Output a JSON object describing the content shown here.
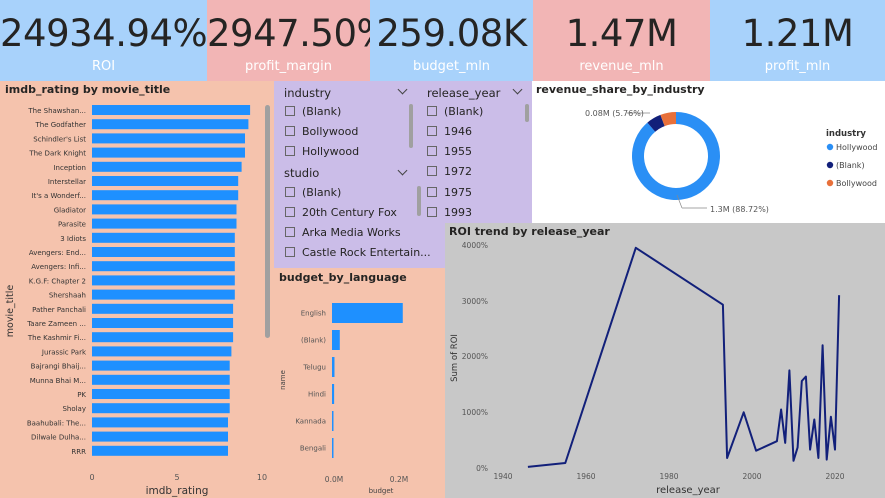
{
  "kpis": [
    {
      "value": "24934.94%",
      "label": "ROI",
      "color": "blue"
    },
    {
      "value": "2947.50%",
      "label": "profit_margin",
      "color": "pink"
    },
    {
      "value": "259.08K",
      "label": "budget_mln",
      "color": "blue"
    },
    {
      "value": "1.47M",
      "label": "revenue_mln",
      "color": "pink"
    },
    {
      "value": "1.21M",
      "label": "profit_mln",
      "color": "blue"
    }
  ],
  "colors": {
    "kpi_blue": "#a8d2fb",
    "kpi_pink": "#f2b5b5",
    "peach": "#f5c3ad",
    "lavender": "#cbbde8",
    "grey": "#c8c8c8",
    "bar": "#1e90ff",
    "line": "#12207a",
    "hollywood": "#2a8ff5",
    "blank": "#12207a",
    "bollywood": "#e8703a"
  },
  "imdb_chart": {
    "title": "imdb_rating by movie_title",
    "xlabel": "imdb_rating",
    "ylabel": "movie_title",
    "ticks": [
      "0",
      "5",
      "10"
    ],
    "chart_data": {
      "type": "bar",
      "categories": [
        "The Shawshan...",
        "The Godfather",
        "Schindler's List",
        "The Dark Knight",
        "Inception",
        "Interstellar",
        "It's a Wonderf...",
        "Gladiator",
        "Parasite",
        "3 Idiots",
        "Avengers: End...",
        "Avengers: Infi...",
        "K.G.F: Chapter 2",
        "Shershaah",
        "Pather Panchali",
        "Taare Zameen ...",
        "The Kashmir Fi...",
        "Jurassic Park",
        "Bajrangi Bhaij...",
        "Munna Bhai M...",
        "PK",
        "Sholay",
        "Baahubali: The...",
        "Dilwale Dulha...",
        "RRR"
      ],
      "values": [
        9.3,
        9.2,
        9.0,
        9.0,
        8.8,
        8.6,
        8.6,
        8.5,
        8.5,
        8.4,
        8.4,
        8.4,
        8.4,
        8.4,
        8.3,
        8.3,
        8.3,
        8.2,
        8.1,
        8.1,
        8.1,
        8.1,
        8.0,
        8.0,
        8.0
      ],
      "xlim": [
        0,
        10
      ]
    }
  },
  "slicers": {
    "industry": {
      "title": "industry",
      "options": [
        "(Blank)",
        "Bollywood",
        "Hollywood"
      ]
    },
    "studio": {
      "title": "studio",
      "options": [
        "(Blank)",
        "20th Century Fox",
        "Arka Media Works",
        "Castle Rock Entertain..."
      ]
    },
    "release_year": {
      "title": "release_year",
      "options": [
        "(Blank)",
        "1946",
        "1955",
        "1972",
        "1975",
        "1993"
      ]
    }
  },
  "language_chart": {
    "title": "budget_by_language",
    "xlabel": "budget",
    "ylabel": "name",
    "ticks": [
      "0.0M",
      "0.2M"
    ],
    "chart_data": {
      "type": "bar",
      "categories": [
        "English",
        "(Blank)",
        "Telugu",
        "Hindi",
        "Kannada",
        "Bengali"
      ],
      "values": [
        0.2,
        0.022,
        0.007,
        0.006,
        0.002,
        0.001
      ],
      "xlim": [
        0,
        0.26
      ]
    }
  },
  "donut_chart": {
    "title": "revenue_share_by_industry",
    "legend_title": "industry",
    "legend": [
      "Hollywood",
      "(Blank)",
      "Bollywood"
    ],
    "label_top": "0.08M (5.76%)",
    "label_bottom": "1.3M (88.72%)",
    "chart_data": {
      "type": "pie",
      "categories": [
        "Hollywood",
        "(Blank)",
        "Bollywood"
      ],
      "values": [
        88.72,
        5.52,
        5.76
      ]
    }
  },
  "roi_chart": {
    "title": "ROI trend by release_year",
    "xlabel": "release_year",
    "ylabel": "Sum of ROI",
    "yticks": [
      "0%",
      "1000%",
      "2000%",
      "3000%",
      "4000%"
    ],
    "xticks": [
      "1940",
      "1960",
      "1980",
      "2000",
      "2020"
    ],
    "chart_data": {
      "type": "line",
      "x": [
        1946,
        1955,
        1972,
        1993,
        1994,
        1998,
        2001,
        2006,
        2007,
        2008,
        2009,
        2010,
        2011,
        2012,
        2013,
        2014,
        2015,
        2016,
        2017,
        2018,
        2019,
        2020,
        2021
      ],
      "y": [
        20,
        90,
        3950,
        2930,
        180,
        1000,
        310,
        480,
        1050,
        450,
        1750,
        130,
        370,
        1560,
        1640,
        330,
        870,
        180,
        2200,
        150,
        920,
        330,
        3100
      ],
      "xlim": [
        1940,
        2025
      ],
      "ylim": [
        0,
        4000
      ]
    }
  }
}
